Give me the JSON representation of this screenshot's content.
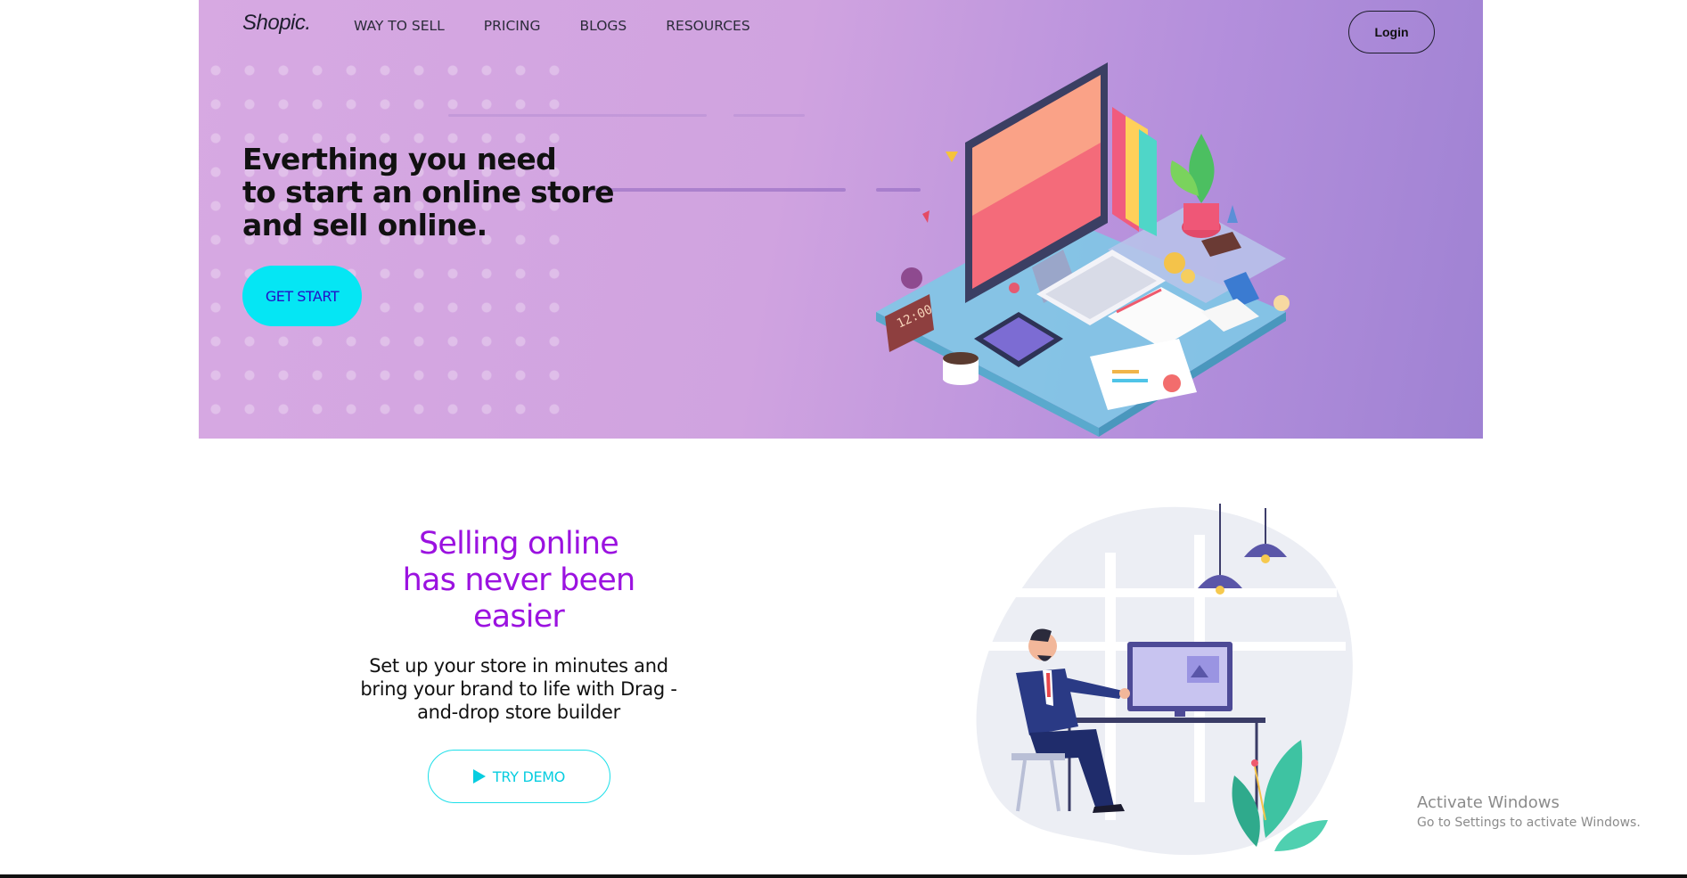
{
  "brand": {
    "logo": "Shopic."
  },
  "nav": {
    "items": [
      {
        "label": "WAY TO SELL"
      },
      {
        "label": "PRICING"
      },
      {
        "label": "BLOGS"
      },
      {
        "label": "RESOURCES"
      }
    ],
    "login_label": "Login"
  },
  "hero": {
    "title_lines": [
      "Everthing you need",
      "to start an online store",
      "and sell online."
    ],
    "cta_label": "GET START",
    "clock_text": "12:00"
  },
  "section": {
    "title_lines": [
      "Selling online",
      "has never been",
      "easier"
    ],
    "desc_lines": [
      "Set up your store in minutes and",
      "bring your brand to life with Drag -",
      "and-drop store builder"
    ],
    "demo_label": "TRY DEMO"
  },
  "watermark": {
    "title": "Activate Windows",
    "subtitle": "Go to Settings to activate Windows."
  },
  "colors": {
    "accent_cyan": "#05e6f4",
    "title_purple": "#9b12e0",
    "hero_bg": "#d0a3e0"
  }
}
